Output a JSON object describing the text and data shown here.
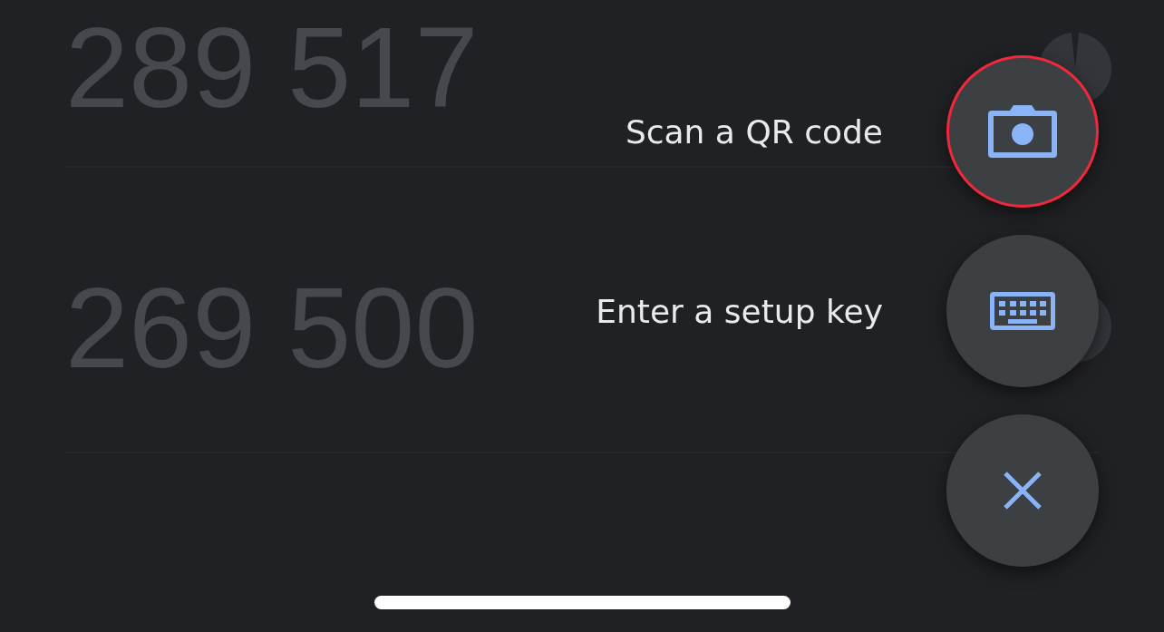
{
  "codes": [
    {
      "code": "289 517"
    },
    {
      "code": "269 500"
    }
  ],
  "menu": [
    {
      "label": "Scan a QR code",
      "kind": "camera",
      "selected": true
    },
    {
      "label": "Enter a setup key",
      "kind": "keyboard",
      "selected": false
    }
  ]
}
